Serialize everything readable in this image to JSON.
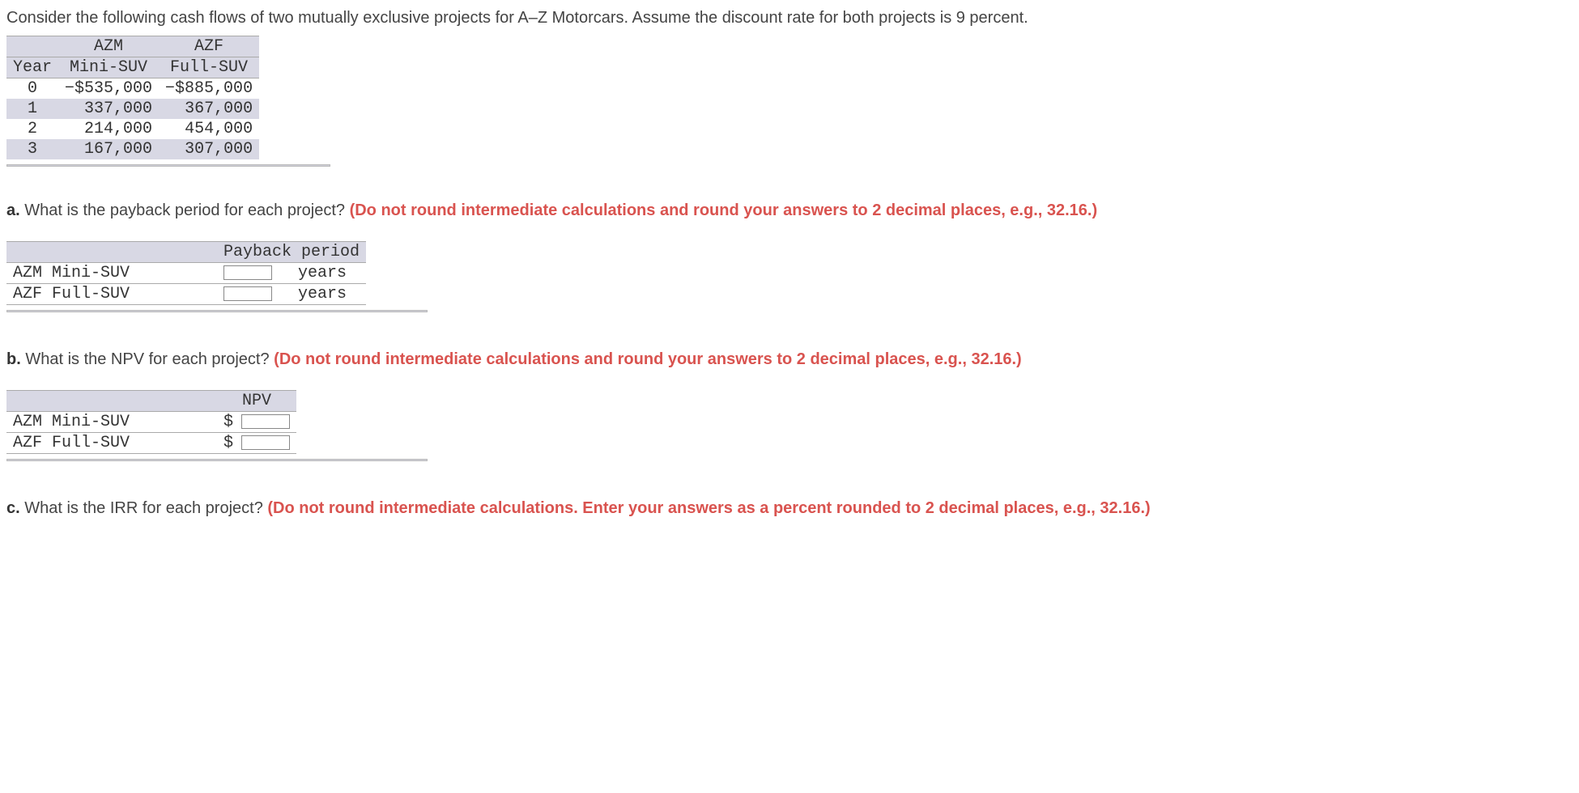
{
  "intro": "Consider the following cash flows of two mutually exclusive projects for A–Z Motorcars. Assume the discount rate for both projects is 9 percent.",
  "cashflow_table": {
    "headers": {
      "year": "Year",
      "azm_top": "AZM",
      "azm_bot": "Mini-SUV",
      "azf_top": "AZF",
      "azf_bot": "Full-SUV"
    },
    "rows": [
      {
        "year": "0",
        "azm": "−$535,000",
        "azf": "−$885,000"
      },
      {
        "year": "1",
        "azm": "337,000",
        "azf": "367,000"
      },
      {
        "year": "2",
        "azm": "214,000",
        "azf": "454,000"
      },
      {
        "year": "3",
        "azm": "167,000",
        "azf": "307,000"
      }
    ]
  },
  "qa": {
    "label": "a.",
    "text": " What is the payback period for each project? ",
    "hint": "(Do not round intermediate calculations and round your answers to 2 decimal places, e.g., 32.16.)"
  },
  "payback_table": {
    "header": "Payback period",
    "rows": [
      {
        "label": "AZM Mini-SUV",
        "unit": "years"
      },
      {
        "label": "AZF Full-SUV",
        "unit": "years"
      }
    ]
  },
  "qb": {
    "label": "b.",
    "text": " What is the NPV for each project? ",
    "hint": "(Do not round intermediate calculations and round your answers to 2 decimal places, e.g., 32.16.)"
  },
  "npv_table": {
    "header": "NPV",
    "rows": [
      {
        "label": "AZM Mini-SUV",
        "currency": "$"
      },
      {
        "label": "AZF Full-SUV",
        "currency": "$"
      }
    ]
  },
  "qc": {
    "label": "c.",
    "text": " What is the IRR for each project? ",
    "hint": "(Do not round intermediate calculations. Enter your answers as a percent rounded to 2 decimal places, e.g., 32.16.)"
  }
}
